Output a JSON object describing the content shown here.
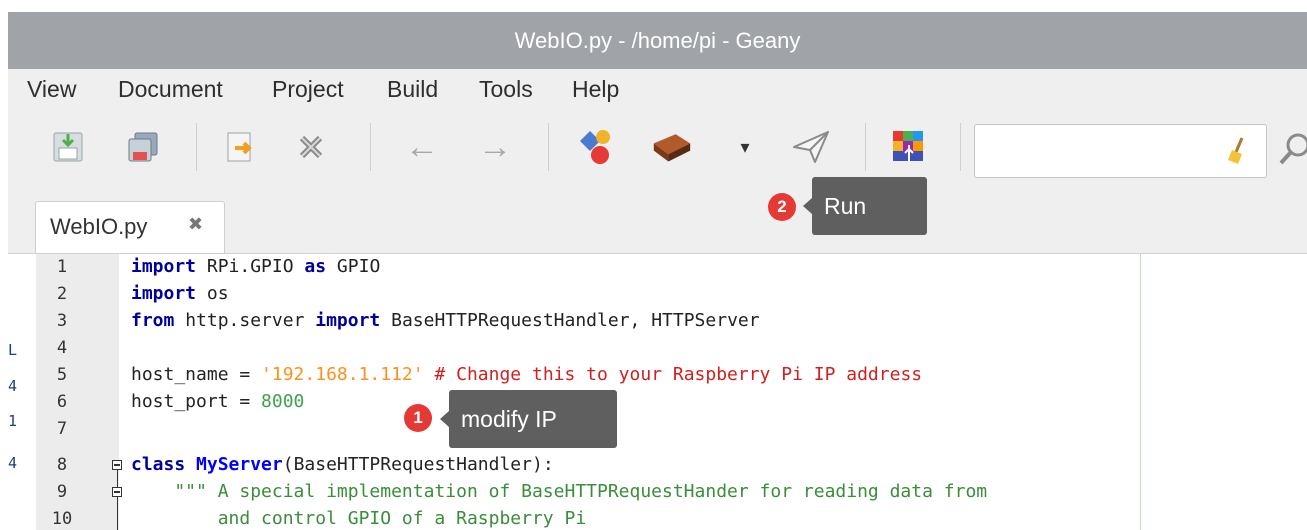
{
  "window": {
    "title": "WebIO.py - /home/pi - Geany"
  },
  "menu": [
    "View",
    "Document",
    "Project",
    "Build",
    "Tools",
    "Help"
  ],
  "toolbar": {
    "icons": [
      "save-icon",
      "save-all-icon",
      "revert-icon",
      "close-file-icon",
      "back-arrow-icon",
      "forward-arrow-icon",
      "compile-icon",
      "build-icon",
      "build-dropdown-icon",
      "run-icon",
      "color-chooser-icon",
      "clear-search-icon",
      "search-icon"
    ],
    "back_glyph": "←",
    "forward_glyph": "→",
    "dropdown_glyph": "▾",
    "search_value": ""
  },
  "tab": {
    "label": "WebIO.py",
    "close_glyph": "✖"
  },
  "annotations": [
    {
      "badge": "2",
      "label": "Run"
    },
    {
      "badge": "1",
      "label": "modify IP"
    }
  ],
  "line_numbers": [
    "1",
    "2",
    "3",
    "4",
    "5",
    "6",
    "7",
    "8",
    "9",
    "10"
  ],
  "code": {
    "l1": {
      "kw1": "import",
      "a": " RPi.GPIO ",
      "kw2": "as",
      "b": " GPIO"
    },
    "l2": {
      "kw1": "import",
      "a": " os"
    },
    "l3": {
      "kw1": "from",
      "a": " http.server ",
      "kw2": "import",
      "b": " BaseHTTPRequestHandler, HTTPServer"
    },
    "l5": {
      "a": "host_name = ",
      "str": "'192.168.1.112'",
      "b": " ",
      "cm": "# Change this to your Raspberry Pi IP address"
    },
    "l6": {
      "a": "host_port = ",
      "num": "8000"
    },
    "l8": {
      "kw1": "class",
      "b": " ",
      "cls": "MyServer",
      "c": "(BaseHTTPRequestHandler):"
    },
    "l9": {
      "doc": "    \"\"\" A special implementation of BaseHTTPRequestHander for reading data from"
    },
    "l10": {
      "doc": "        and control GPIO of a Raspberry Pi"
    }
  },
  "left_marks": [
    "L",
    "4",
    "1",
    "4"
  ],
  "colors": {
    "titlebar": "#a0a4a8",
    "chrome": "#efefef",
    "keyword": "#00009c",
    "string": "#ff901e",
    "comment": "#d11f1f",
    "number": "#3fa24a",
    "docstring": "#3a8d3a",
    "badge": "#e53935",
    "tooltip": "#5f5f5f"
  }
}
